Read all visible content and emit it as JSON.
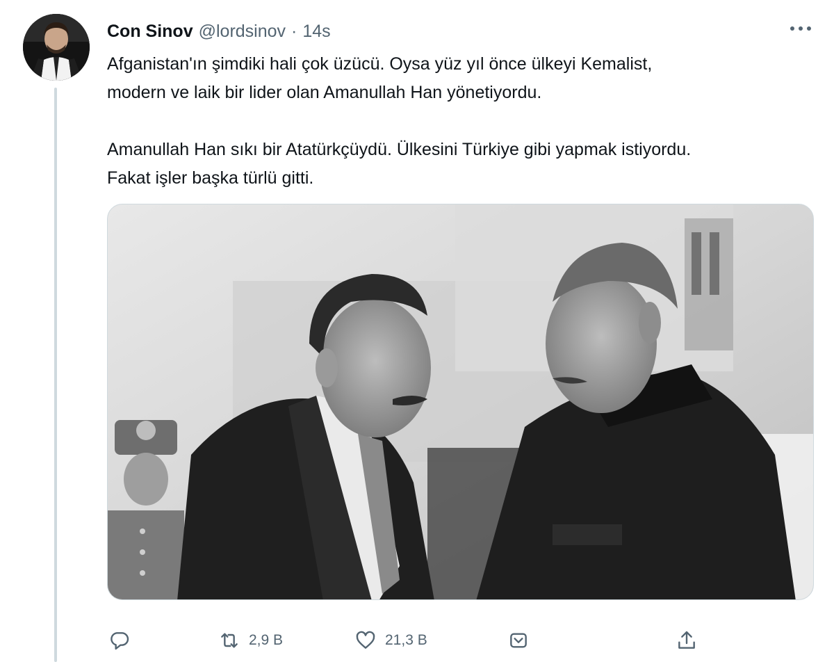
{
  "tweet": {
    "display_name": "Con Sinov",
    "handle": "@lordsinov",
    "separator": "·",
    "time": "14s",
    "paragraphs": [
      "Afganistan'ın şimdiki hali çok üzücü. Oysa yüz yıl önce ülkeyi Kemalist,",
      "modern ve laik bir lider olan Amanullah Han yönetiyordu.",
      "Amanullah Han sıkı bir Atatürkçüydü. Ülkesini Türkiye gibi yapmak istiyordu.",
      "Fakat işler başka türlü gitti."
    ]
  },
  "actions": {
    "reply": {
      "icon": "reply-icon"
    },
    "retweet": {
      "icon": "retweet-icon",
      "count": "2,9 B"
    },
    "like": {
      "icon": "heart-icon",
      "count": "21,3 B"
    },
    "tip": {
      "icon": "tip-icon"
    },
    "share": {
      "icon": "share-icon"
    }
  },
  "colors": {
    "text": "#0f1419",
    "secondary": "#536471",
    "thread_line": "#cfd9de"
  }
}
